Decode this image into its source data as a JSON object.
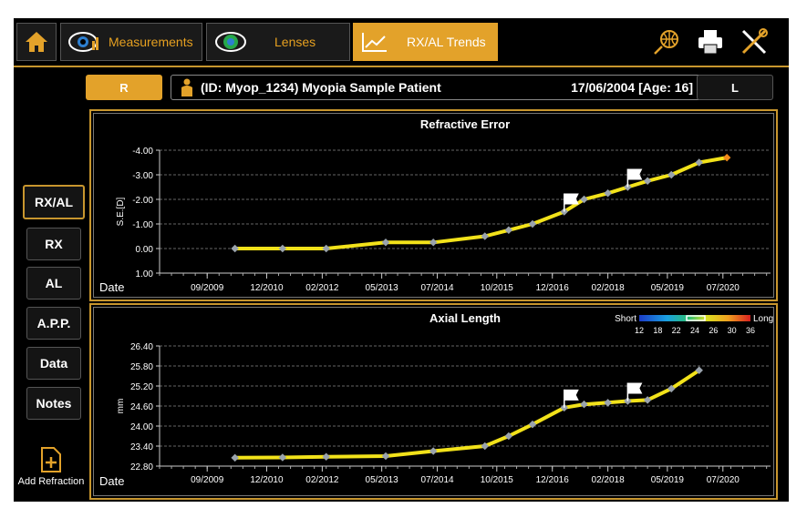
{
  "tabs": [
    {
      "label": "Measurements",
      "icon": "eye-measure-icon",
      "active": false
    },
    {
      "label": "Lenses",
      "icon": "lens-eye-icon",
      "active": false
    },
    {
      "label": "RX/AL Trends",
      "icon": "trend-chart-icon",
      "active": true
    }
  ],
  "toolbar": {
    "globe": "globe-icon",
    "print": "printer-icon",
    "tools": "tools-icon",
    "home": "home-icon"
  },
  "eye": {
    "right_label": "R",
    "left_label": "L",
    "selected": "R"
  },
  "patient": {
    "text": "(ID: Myop_1234) Myopia Sample Patient",
    "dob": "17/06/2004 [Age: 16]"
  },
  "side_nav": [
    {
      "label": "RX/AL",
      "selected": true
    },
    {
      "label": "RX",
      "selected": false
    },
    {
      "label": "AL",
      "selected": false
    },
    {
      "label": "A.P.P.",
      "selected": false
    },
    {
      "label": "Data",
      "selected": false
    },
    {
      "label": "Notes",
      "selected": false
    }
  ],
  "add_refraction": {
    "label": "Add Refraction"
  },
  "colors": {
    "accent": "#e3a22a",
    "line": "#f2e21a",
    "point": "#9aa3ad",
    "grid": "#666666"
  },
  "chart_data": [
    {
      "type": "line",
      "title": "Refractive Error",
      "xlabel": "Date",
      "ylabel": "S.E.[D]",
      "x_ticks": [
        "09/2009",
        "12/2010",
        "02/2012",
        "05/2013",
        "07/2014",
        "10/2015",
        "12/2016",
        "02/2018",
        "05/2019",
        "07/2020"
      ],
      "y_ticks": [
        "-4.00",
        "-3.00",
        "-2.00",
        "-1.00",
        "0.00",
        "1.00"
      ],
      "ylim": [
        1.0,
        -4.0
      ],
      "x": [
        "2010-04",
        "2011-04",
        "2012-03",
        "2013-06",
        "2014-06",
        "2015-07",
        "2016-01",
        "2016-07",
        "2017-03",
        "2017-08",
        "2018-02",
        "2018-07",
        "2018-12",
        "2019-06",
        "2020-01",
        "2020-08"
      ],
      "values": [
        0.0,
        0.0,
        0.0,
        -0.25,
        -0.25,
        -0.5,
        -0.75,
        -1.0,
        -1.5,
        -2.0,
        -2.25,
        -2.5,
        -2.75,
        -3.0,
        -3.5,
        -3.7
      ],
      "flags_at_index": [
        8,
        11
      ],
      "grid": true
    },
    {
      "type": "line",
      "title": "Axial Length",
      "xlabel": "Date",
      "ylabel": "mm",
      "x_ticks": [
        "09/2009",
        "12/2010",
        "02/2012",
        "05/2013",
        "07/2014",
        "10/2015",
        "12/2016",
        "02/2018",
        "05/2019",
        "07/2020"
      ],
      "y_ticks": [
        "26.40",
        "25.80",
        "25.20",
        "24.60",
        "24.00",
        "23.40",
        "22.80"
      ],
      "ylim": [
        22.8,
        26.4
      ],
      "x": [
        "2010-04",
        "2011-04",
        "2012-03",
        "2013-06",
        "2014-06",
        "2015-07",
        "2016-01",
        "2016-07",
        "2017-03",
        "2017-08",
        "2018-02",
        "2018-07",
        "2018-12",
        "2019-06",
        "2020-01"
      ],
      "values": [
        23.05,
        23.06,
        23.08,
        23.1,
        23.25,
        23.4,
        23.7,
        24.05,
        24.55,
        24.65,
        24.7,
        24.75,
        24.78,
        25.12,
        25.67
      ],
      "flags_at_index": [
        8,
        11
      ],
      "grid": true,
      "legend": {
        "short_label": "Short",
        "long_label": "Long",
        "ticks": [
          "12",
          "18",
          "22",
          "24",
          "26",
          "30",
          "36"
        ],
        "placement": "top-right"
      }
    }
  ]
}
